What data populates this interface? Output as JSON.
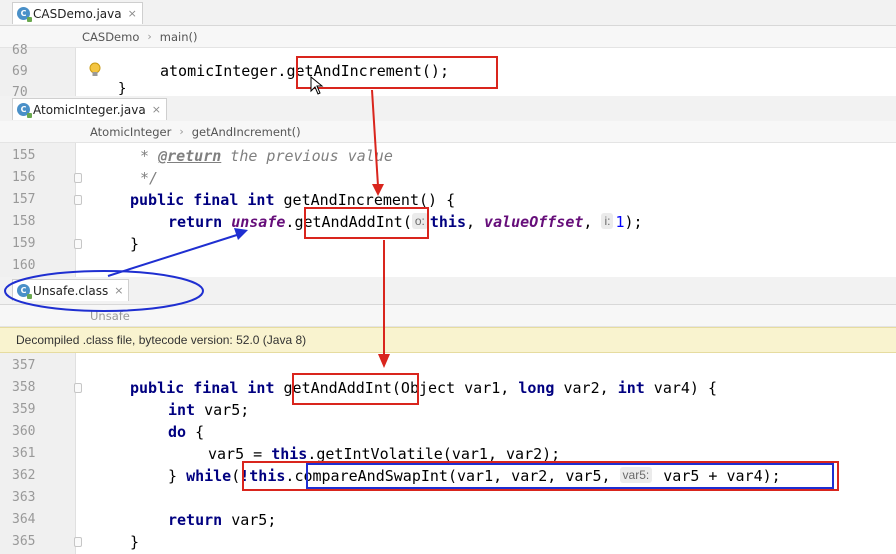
{
  "tab1": {
    "label": "CASDemo.java",
    "close": "×"
  },
  "crumb1": {
    "items": [
      "CASDemo",
      "main()"
    ]
  },
  "editor1": {
    "lines": [
      {
        "no": "68"
      },
      {
        "no": "69",
        "code_obj": "atomicInteger.",
        "code_call": "getAndIncrement();"
      },
      {
        "no": "70",
        "code": "}"
      }
    ]
  },
  "tab2": {
    "label": "AtomicInteger.java",
    "close": "×"
  },
  "crumb2": {
    "items": [
      "AtomicInteger",
      "getAndIncrement()"
    ]
  },
  "editor2": {
    "lines": [
      {
        "no": "155",
        "star": "* ",
        "tag": "@return",
        "text": " the previous value"
      },
      {
        "no": "156",
        "text": "*/"
      },
      {
        "no": "157",
        "kw": "public final int ",
        "method": "getAndIncrement() {"
      },
      {
        "no": "158",
        "kw": "return ",
        "field": "unsafe",
        "dot": ".",
        "call": "getAndAddInt",
        "paren": "(",
        "hint1": "o:",
        "this": "this",
        "comma1": ", ",
        "field2": "valueOffset",
        "comma2": ", ",
        "hint2": "i:",
        "num": "1",
        "end": ");"
      },
      {
        "no": "159",
        "text": "}"
      },
      {
        "no": "160",
        "text": ""
      }
    ]
  },
  "tab3": {
    "label": "Unsafe.class",
    "close": "×"
  },
  "crumb3": {
    "items": [
      "Unsafe"
    ]
  },
  "banner": {
    "text": "Decompiled .class file, bytecode version: 52.0 (Java 8)"
  },
  "editor3": {
    "lines": [
      {
        "no": "357"
      },
      {
        "no": "358",
        "kw": "public final int ",
        "call": "getAndAddInt",
        "p1": "(Object var1, ",
        "kw2": "long",
        "p2": " var2, ",
        "kw3": "int",
        "p3": " var4) {"
      },
      {
        "no": "359",
        "kw": "int",
        "text": " var5;"
      },
      {
        "no": "360",
        "kw": "do",
        "text": " {"
      },
      {
        "no": "361",
        "a": "var5 = ",
        "kw": "this",
        "b": ".getIntVolatile(var1, var2);"
      },
      {
        "no": "362",
        "a": "} ",
        "kw": "while",
        "b": "(",
        "neg": "!",
        "kw2": "this",
        "dot": ".",
        "call": "compareAndSwapInt(var1, var2, var5, ",
        "hint": "var5:",
        "rest": " var5 + var4",
        "end": ");"
      },
      {
        "no": "363"
      },
      {
        "no": "364",
        "kw": "return",
        "text": " var5;"
      },
      {
        "no": "365",
        "text": "}"
      }
    ]
  },
  "colors": {
    "red_annotation": "#d9251d",
    "blue_annotation": "#1f2fd1",
    "keyword": "#000080",
    "field": "#660e7a"
  }
}
